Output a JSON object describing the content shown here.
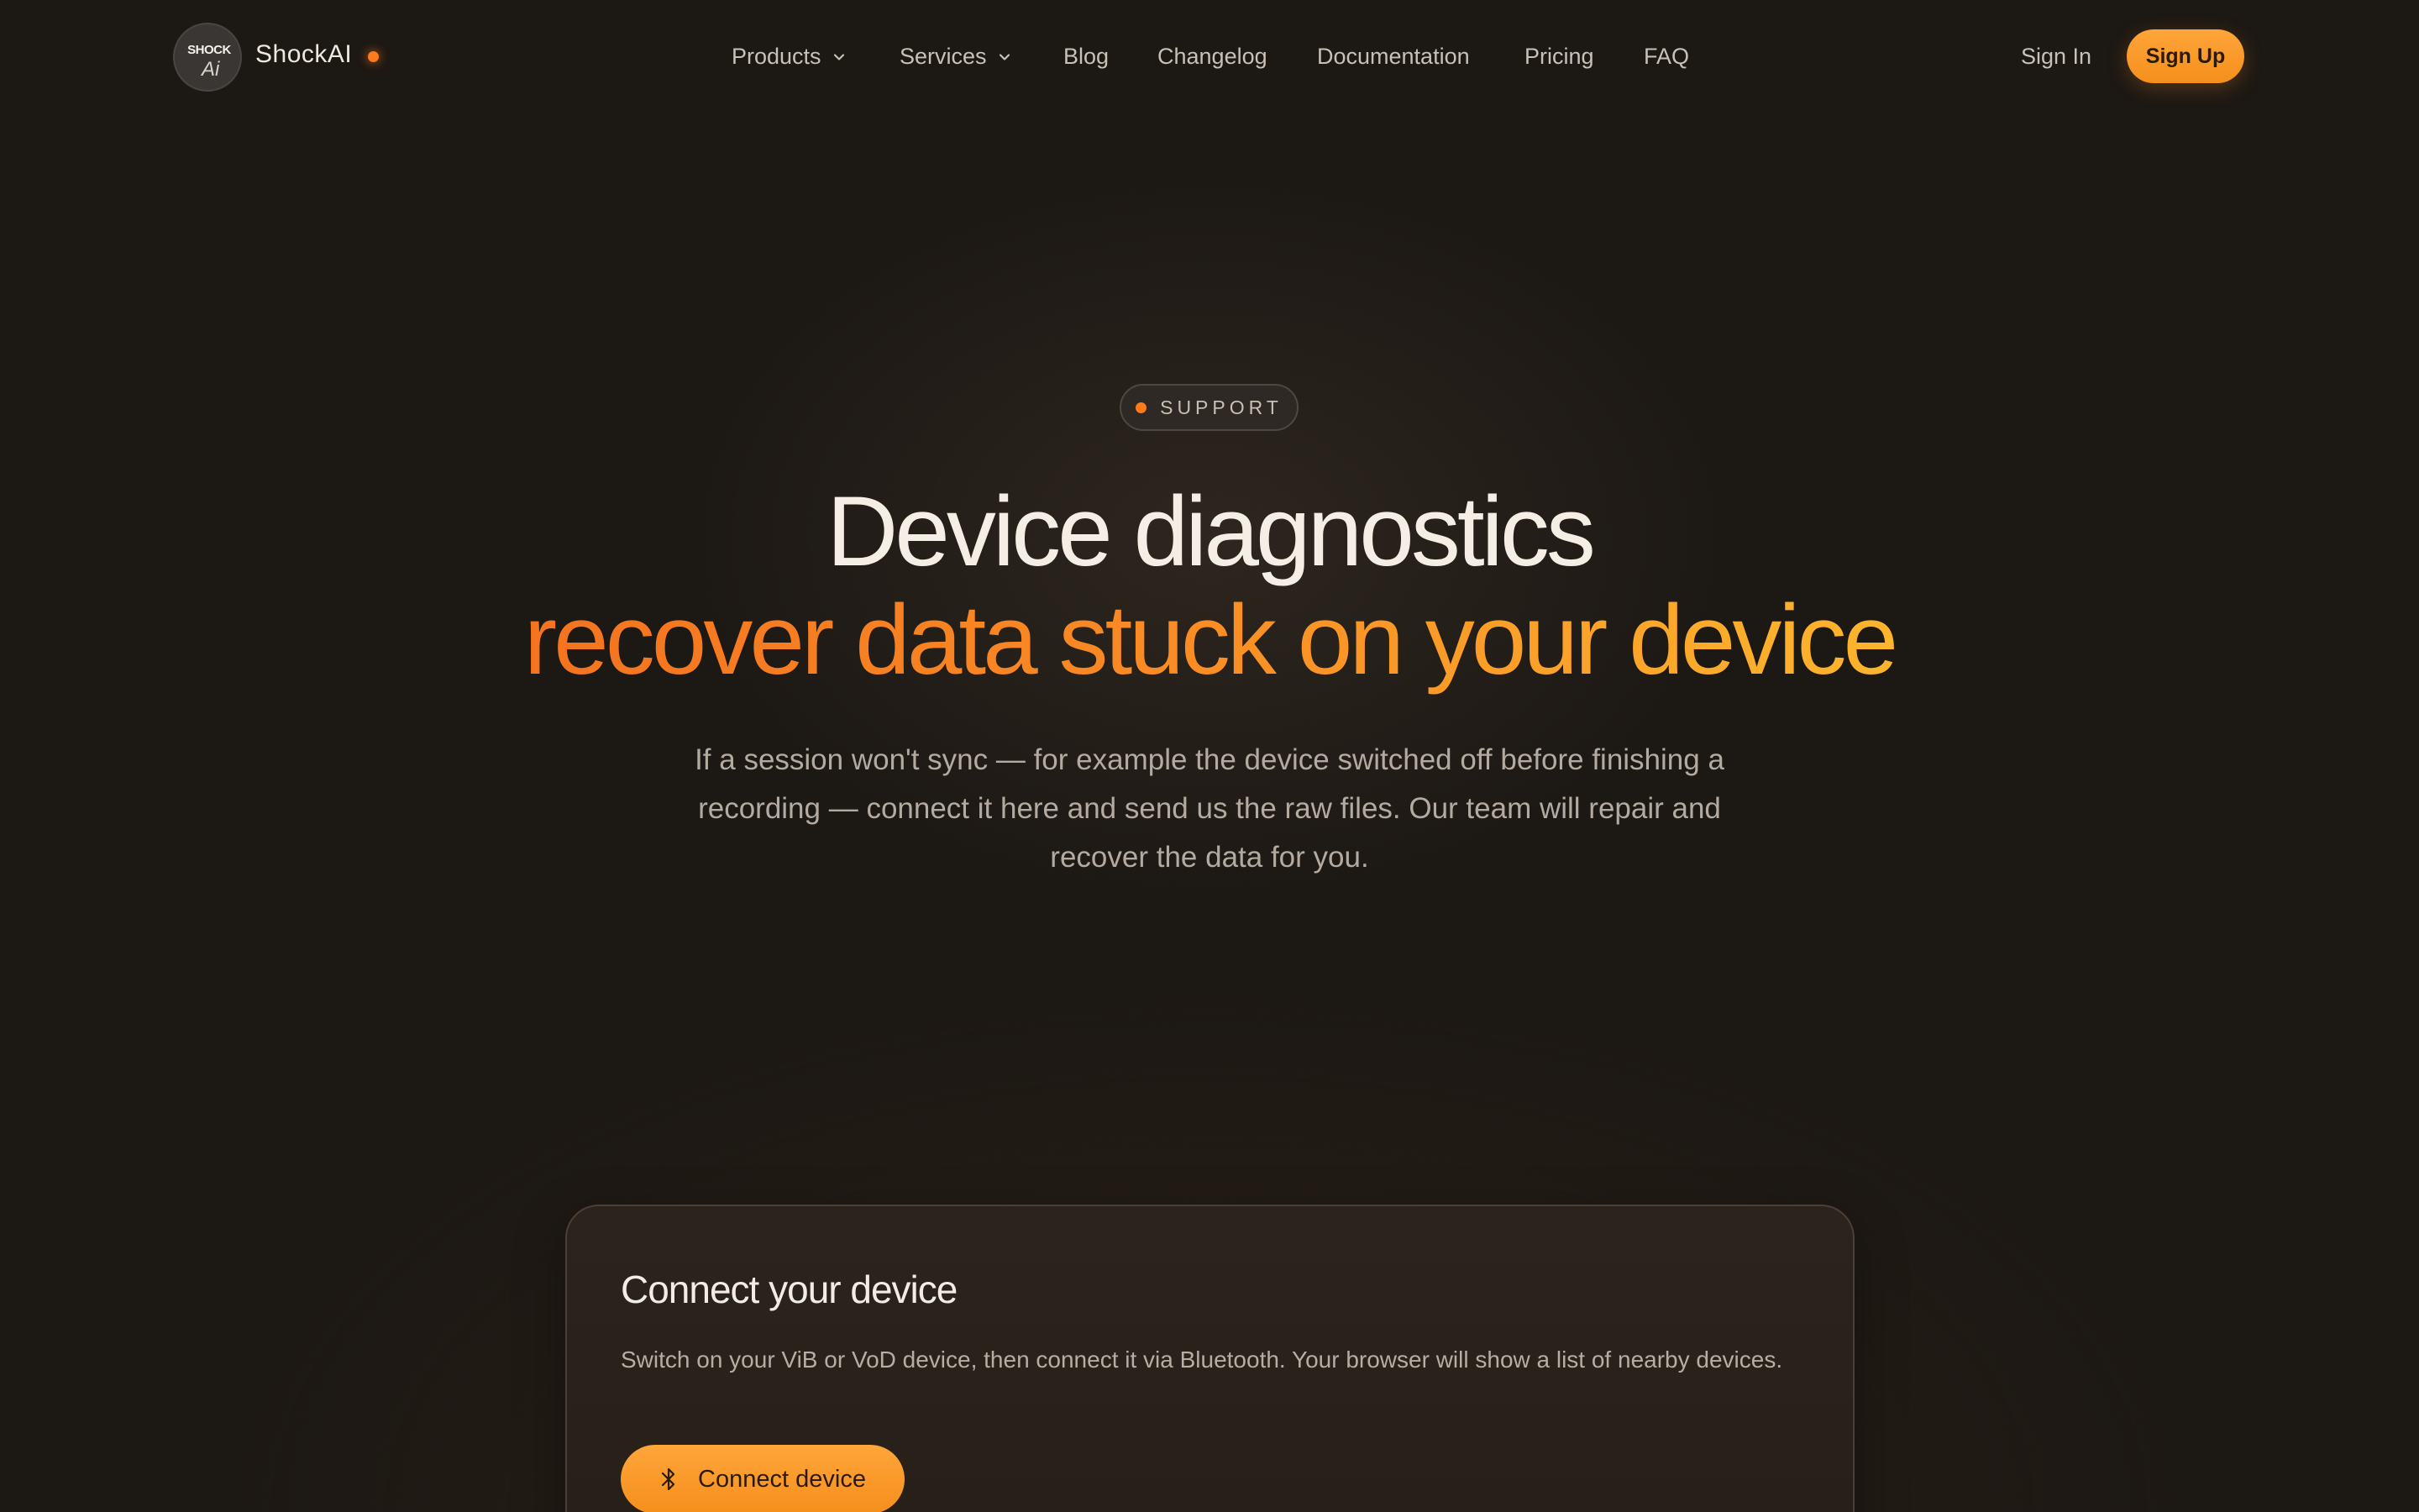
{
  "brand": {
    "logo_line1": "SHOCK",
    "logo_line2": "Ai",
    "name": "ShockAI",
    "accent": "#ff7a1a"
  },
  "nav": {
    "items": [
      {
        "label": "Products",
        "has_dropdown": true
      },
      {
        "label": "Services",
        "has_dropdown": true
      },
      {
        "label": "Blog",
        "has_dropdown": false
      },
      {
        "label": "Changelog",
        "has_dropdown": false
      },
      {
        "label": "Documentation",
        "has_dropdown": false
      },
      {
        "label": "Pricing",
        "has_dropdown": false
      },
      {
        "label": "FAQ",
        "has_dropdown": false
      }
    ],
    "sign_in": "Sign In",
    "sign_up": "Sign Up"
  },
  "hero": {
    "badge": "SUPPORT",
    "title_line1": "Device diagnostics",
    "title_line2": "recover data stuck on your device",
    "lead": "If a session won't sync — for example the device switched off before finishing a recording — connect it here and send us the raw files. Our team will repair and recover the data for you."
  },
  "card": {
    "title": "Connect your device",
    "description": "Switch on your ViB or VoD device, then connect it via Bluetooth. Your browser will show a list of nearby devices.",
    "button_label": "Connect device",
    "button_icon": "bluetooth-icon"
  },
  "colors": {
    "background": "#1c1814",
    "primary_button": "#f7952a",
    "gradient_start": "#f4731f",
    "gradient_end": "#fcb52d"
  }
}
